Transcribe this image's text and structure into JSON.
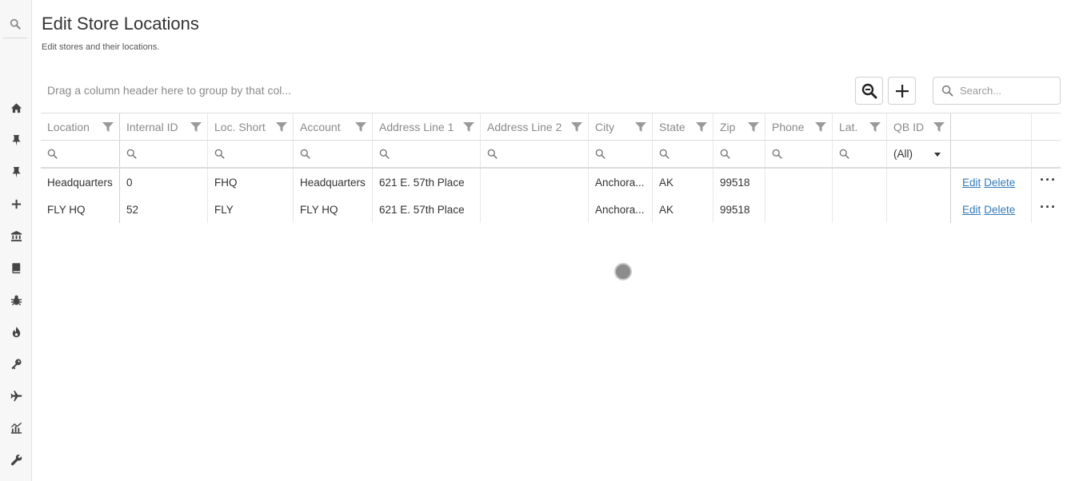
{
  "header": {
    "title": "Edit Store Locations",
    "subtitle": "Edit stores and their locations."
  },
  "toolbar": {
    "group_panel_text": "Drag a column header here to group by that col...",
    "search_placeholder": "Search..."
  },
  "grid": {
    "columns": [
      "Location",
      "Internal ID",
      "Loc. Short",
      "Account",
      "Address Line 1",
      "Address Line 2",
      "City",
      "State",
      "Zip",
      "Phone",
      "Lat.",
      "QB ID"
    ],
    "qbid_filter_value": "(All)",
    "rows": [
      {
        "location": "Headquarters",
        "internal_id": "0",
        "loc_short": "FHQ",
        "account": "Headquarters",
        "address1": "621 E. 57th Place",
        "address2": "",
        "city": "Anchora...",
        "state": "AK",
        "zip": "99518",
        "phone": "",
        "lat": "",
        "qbid": "",
        "edit": "Edit",
        "delete": "Delete",
        "more": "···"
      },
      {
        "location": "FLY HQ",
        "internal_id": "52",
        "loc_short": "FLY",
        "account": "FLY HQ",
        "address1": "621 E. 57th Place",
        "address2": "",
        "city": "Anchora...",
        "state": "AK",
        "zip": "99518",
        "phone": "",
        "lat": "",
        "qbid": "",
        "edit": "Edit",
        "delete": "Delete",
        "more": "···"
      }
    ]
  },
  "sidebar": {
    "icons": [
      "search-icon",
      "home-icon",
      "pin-icon",
      "pin-icon",
      "plus-icon",
      "bank-icon",
      "book-icon",
      "bug-icon",
      "fire-icon",
      "key-icon",
      "plane-icon",
      "chart-icon",
      "wrench-icon"
    ]
  }
}
